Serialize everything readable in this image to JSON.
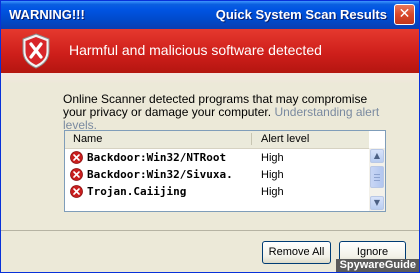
{
  "window": {
    "title_left": "WARNING!!!",
    "title_right": "Quick System Scan Results",
    "close_glyph": "✕"
  },
  "banner": {
    "text": "Harmful and malicious software detected",
    "icon": "shield-x-icon"
  },
  "description": {
    "text": "Online Scanner detected programs that may compromise your privacy or damage your computer.",
    "link_text": "Understanding alert levels."
  },
  "table": {
    "columns": [
      "Name",
      "Alert level"
    ],
    "rows": [
      {
        "name": "Backdoor:Win32/NTRoot",
        "level": "High"
      },
      {
        "name": "Backdoor:Win32/Sivuxa.",
        "level": "High"
      },
      {
        "name": "Trojan.Caiijing",
        "level": "High"
      }
    ],
    "scroll_up_glyph": "▲",
    "scroll_down_glyph": "▼"
  },
  "buttons": {
    "remove_all": "Remove All",
    "ignore": "Ignore"
  },
  "watermark": "SpywareGuide",
  "colors": {
    "title_bar": "#0054e3",
    "banner_red": "#cf1f1b",
    "threat_icon": "#c81e1e"
  }
}
